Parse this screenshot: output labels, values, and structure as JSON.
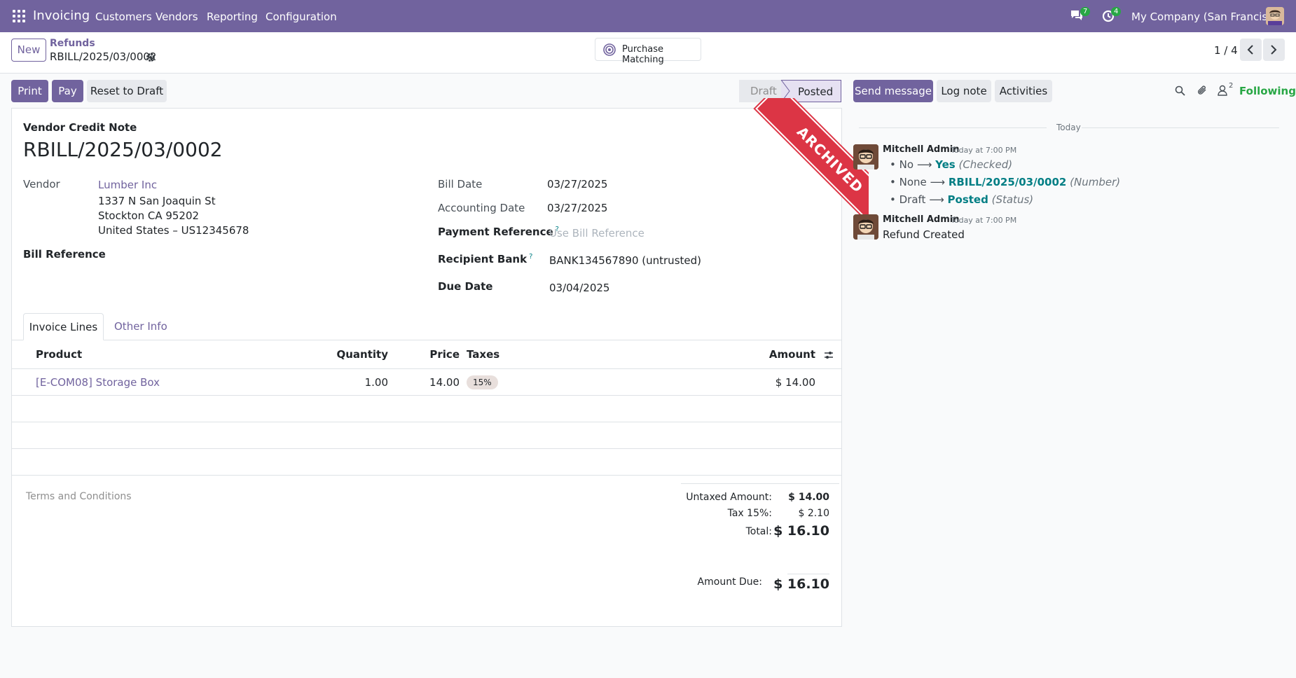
{
  "navbar": {
    "app_name": "Invoicing",
    "menu": [
      "Customers",
      "Vendors",
      "Reporting",
      "Configuration"
    ],
    "messages_count": "7",
    "activities_count": "4",
    "company": "My Company (San Francisco)"
  },
  "control_panel": {
    "new_label": "New",
    "breadcrumb_parent": "Refunds",
    "breadcrumb_current": "RBILL/2025/03/0002",
    "purchase_matching_label": "Purchase Matching",
    "pager": "1 / 4"
  },
  "actions": {
    "print": "Print",
    "pay": "Pay",
    "reset": "Reset to Draft"
  },
  "status": {
    "draft": "Draft",
    "posted": "Posted"
  },
  "ribbon": "ARCHIVED",
  "form": {
    "doc_type": "Vendor Credit Note",
    "number": "RBILL/2025/03/0002",
    "vendor_label": "Vendor",
    "vendor_name": "Lumber Inc",
    "vendor_address_1": "1337 N San Joaquin St",
    "vendor_address_2": "Stockton CA 95202",
    "vendor_address_3": "United States – US12345678",
    "bill_reference_label": "Bill Reference",
    "bill_date_label": "Bill Date",
    "bill_date": "03/27/2025",
    "accounting_date_label": "Accounting Date",
    "accounting_date": "03/27/2025",
    "payment_reference_label": "Payment Reference",
    "payment_reference_placeholder": "Use Bill Reference",
    "recipient_bank_label": "Recipient Bank",
    "recipient_bank": "BANK134567890 (untrusted)",
    "due_date_label": "Due Date",
    "due_date": "03/04/2025",
    "help_mark": "?"
  },
  "tabs": [
    "Invoice Lines",
    "Other Info"
  ],
  "lines": {
    "columns": [
      "Product",
      "Quantity",
      "Price",
      "Taxes",
      "Amount"
    ],
    "rows": [
      {
        "product": "[E-COM08] Storage Box",
        "quantity": "1.00",
        "price": "14.00",
        "tax": "15%",
        "amount": "$ 14.00"
      }
    ]
  },
  "terms_placeholder": "Terms and Conditions",
  "totals": {
    "untaxed_label": "Untaxed Amount:",
    "untaxed": "$ 14.00",
    "tax_label": "Tax 15%:",
    "tax": "$ 2.10",
    "total_label": "Total:",
    "total": "$ 16.10",
    "due_label": "Amount Due:",
    "due": "$ 16.10"
  },
  "chatter": {
    "send_message": "Send message",
    "log_note": "Log note",
    "activities": "Activities",
    "followers_count": "2",
    "following": "Following",
    "date_separator": "Today",
    "messages": [
      {
        "author": "Mitchell Admin",
        "time": "Today at 7:00 PM",
        "changes": [
          {
            "old": "No",
            "new": "Yes",
            "field": "(Checked)"
          },
          {
            "old": "None",
            "new": "RBILL/2025/03/0002",
            "field": "(Number)"
          },
          {
            "old": "Draft",
            "new": "Posted",
            "field": "(Status)"
          }
        ]
      },
      {
        "author": "Mitchell Admin",
        "time": "Today at 7:00 PM",
        "body": "Refund Created"
      }
    ]
  },
  "colors": {
    "brand": "#71639e",
    "link_teal": "#017e84",
    "ribbon": "#dc3545",
    "badge": "#28a745"
  }
}
